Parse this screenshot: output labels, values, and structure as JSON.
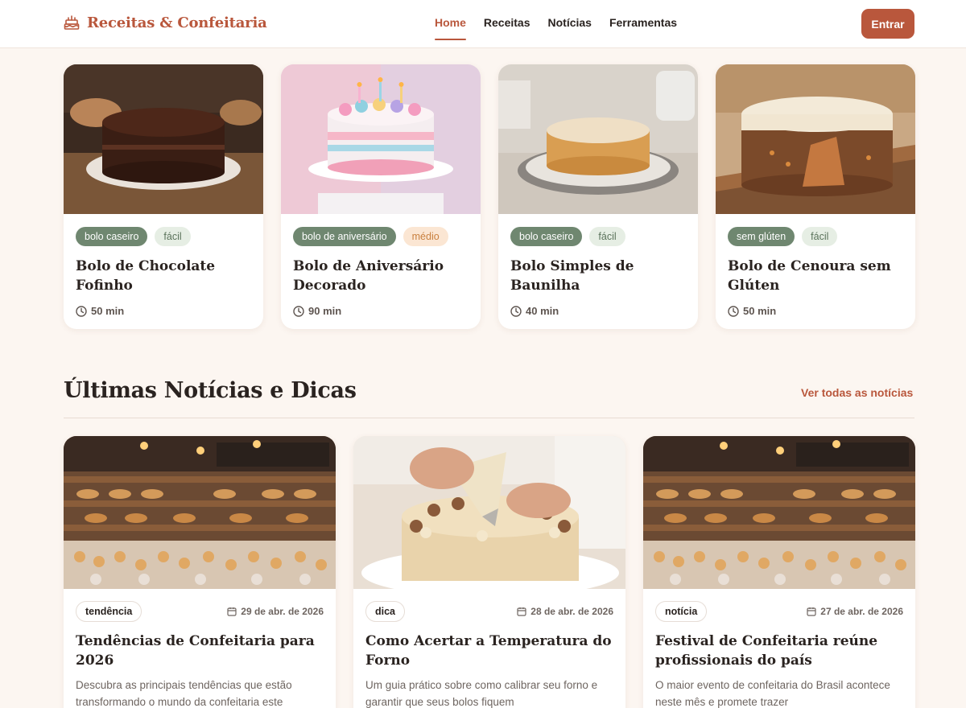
{
  "header": {
    "brand": "Receitas & Confeitaria",
    "nav": [
      {
        "label": "Home",
        "active": true
      },
      {
        "label": "Receitas",
        "active": false
      },
      {
        "label": "Notícias",
        "active": false
      },
      {
        "label": "Ferramentas",
        "active": false
      }
    ],
    "login_label": "Entrar"
  },
  "recipes": [
    {
      "tags": [
        "bolo caseiro",
        "fácil"
      ],
      "title": "Bolo de Chocolate Fofinho",
      "time": "50 min",
      "image": "chocolate-cake-photo"
    },
    {
      "tags": [
        "bolo de aniversário",
        "médio"
      ],
      "title": "Bolo de Aniversário Decorado",
      "time": "90 min",
      "image": "birthday-cake-photo"
    },
    {
      "tags": [
        "bolo caseiro",
        "fácil"
      ],
      "title": "Bolo Simples de Baunilha",
      "time": "40 min",
      "image": "vanilla-cake-photo"
    },
    {
      "tags": [
        "sem glúten",
        "fácil"
      ],
      "title": "Bolo de Cenoura sem Glúten",
      "time": "50 min",
      "image": "carrot-cake-photo"
    }
  ],
  "news_section": {
    "heading": "Últimas Notícias e Dicas",
    "see_all": "Ver todas as notícias"
  },
  "news": [
    {
      "tag": "tendência",
      "date": "29 de abr. de 2026",
      "title": "Tendências de Confeitaria para 2026",
      "excerpt": "Descubra as principais tendências que estão transformando o mundo da confeitaria este",
      "image": "bakery-shop-photo"
    },
    {
      "tag": "dica",
      "date": "28 de abr. de 2026",
      "title": "Como Acertar a Temperatura do Forno",
      "excerpt": "Um guia prático sobre como calibrar seu forno e garantir que seus bolos fiquem",
      "image": "cake-decorating-photo"
    },
    {
      "tag": "notícia",
      "date": "27 de abr. de 2026",
      "title": "Festival de Confeitaria reúne profissionais do país",
      "excerpt": "O maior evento de confeitaria do Brasil acontece neste mês e promete trazer",
      "image": "bakery-shop-photo"
    }
  ],
  "colors": {
    "accent": "#b9573c",
    "background": "#fcf6f1",
    "tag_dark": "#6f8770",
    "tag_light": "#e6eee4",
    "tag_orange": "#fbe6d3"
  }
}
